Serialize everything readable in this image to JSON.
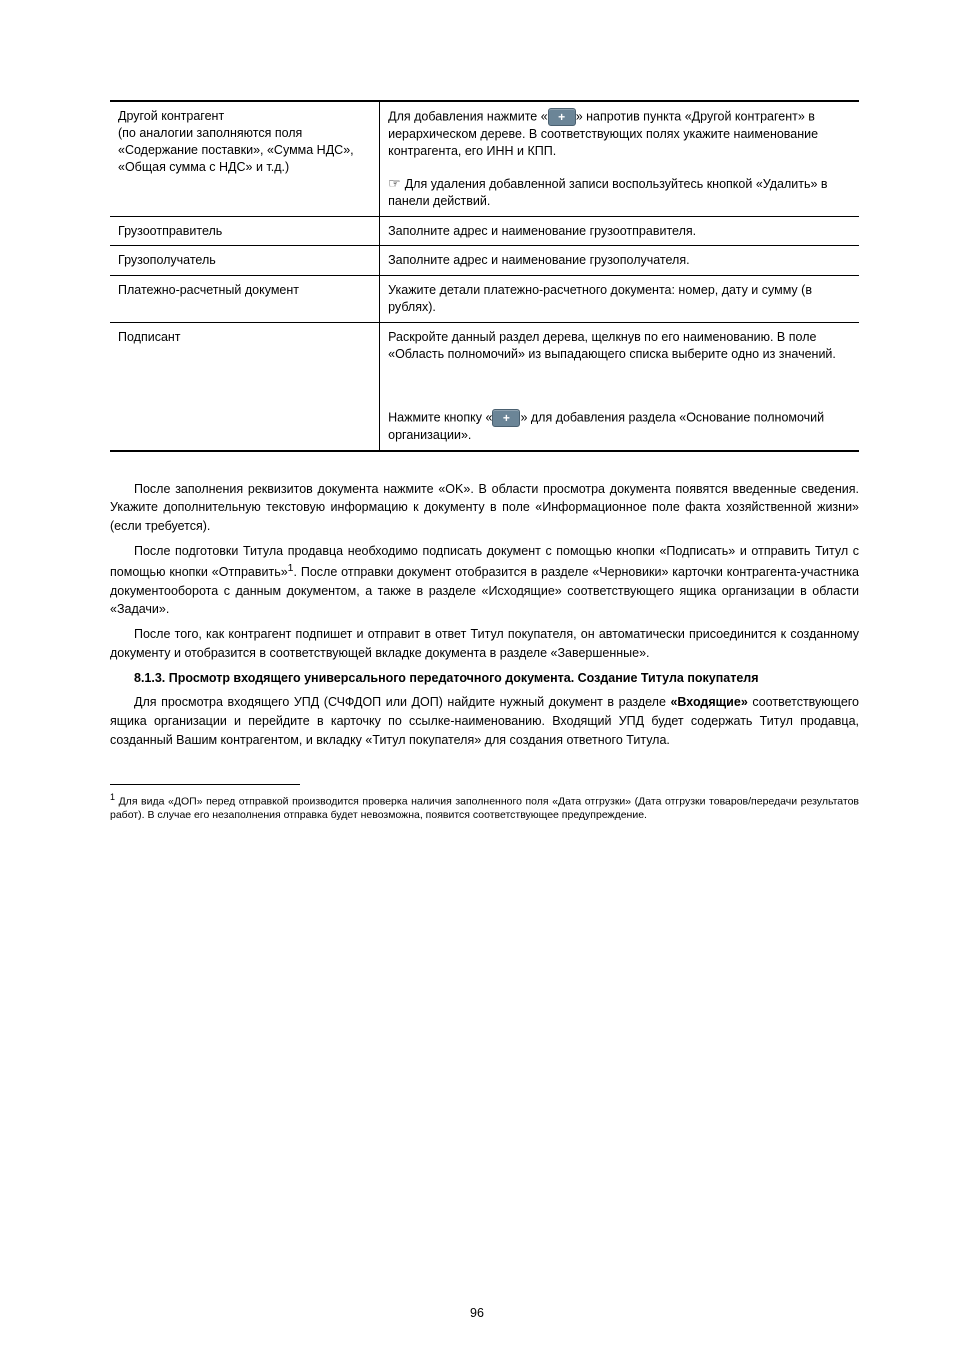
{
  "table": {
    "rows": [
      {
        "left_top": "Другой контрагент",
        "left_sub": "(по аналогии заполняются поля «Содержание поставки», «Сумма НДС», «Общая сумма с НДС» и т.д.)",
        "right_pre": "Для добавления нажмите «",
        "right_post": "» напротив пункта «Другой контрагент» в иерархическом дереве. В соответствующих полях укажите наименование контрагента, его ИНН и КПП.",
        "hand_note": "Для удаления добавленной записи воспользуйтесь кнопкой «Удалить» в панели действий.",
        "has_plus": true,
        "has_hand": true,
        "last": false
      },
      {
        "left_top": "Грузоотправитель",
        "right_pre": "",
        "right_post": "Заполните адрес и наименование грузоотправителя.",
        "has_plus": false,
        "has_hand": false,
        "last": false
      },
      {
        "left_top": "Грузополучатель",
        "right_pre": "",
        "right_post": "Заполните адрес и наименование грузополучателя.",
        "has_plus": false,
        "has_hand": false,
        "last": false
      },
      {
        "left_top": "Платежно-расчетный документ",
        "right_pre": "",
        "right_post": "Укажите детали платежно-расчетного документа: номер, дату и сумму (в рублях).",
        "has_plus": false,
        "has_hand": false,
        "last": false
      },
      {
        "left_top": "Подписант",
        "right_top": "Раскройте данный раздел дерева, щелкнув по его наименованию. В поле «Область полномочий» из выпадающего списка выберите одно из значений.",
        "right_pre": "Нажмите кнопку «",
        "right_post": "» для добавления раздела «Основание полномочий организации».",
        "has_plus": true,
        "has_hand": false,
        "last": true
      }
    ]
  },
  "body": {
    "p1": "После заполнения реквизитов документа нажмите «OK». В области просмотра документа появятся введенные сведения. Укажите дополнительную текстовую информацию к документу в поле «Информационное поле факта хозяйственной жизни» (если требуется).",
    "p2_a": "После подготовки Титула продавца необходимо подписать документ с помощью кнопки «Подписать» и отправить Титул с помощью кнопки «Отправить»",
    "p2_super": "1",
    "p2_b": ". После отправки документ отобразится в разделе «Черновики» карточки контрагента-участника документооборота с данным документом, а также в разделе «Исходящие» соответствующего ящика организации в области «Задачи».",
    "p3": "После того, как контрагент подпишет и отправит в ответ Титул покупателя, он автоматически присоединится к созданному документу и отобразится в соответствующей вкладке документа в разделе «Завершенные».",
    "sec_num": "8.1.3. ",
    "sec_title": "Просмотр входящего универсального передаточного документа. Создание Титула покупателя",
    "p4_a": "Для просмотра входящего УПД (СЧФДОП или ДОП) найдите нужный документ в разделе ",
    "p4_b": "«Входящие»",
    "p4_c": " соответствующего ящика организации и перейдите в карточку по ссылке-наименованию. Входящий УПД будет содержать Титул продавца, созданный Вашим контрагентом, и вкладку «Титул покупателя» для создания ответного Титула."
  },
  "footnote": {
    "sup": "1",
    "text": " Для вида «ДОП» перед отправкой производится проверка наличия заполненного поля «Дата отгрузки» (Дата отгрузки товаров/передачи результатов работ). В случае его незаполнения отправка будет невозможна, появится соответствующее предупреждение."
  },
  "page_number": "96"
}
